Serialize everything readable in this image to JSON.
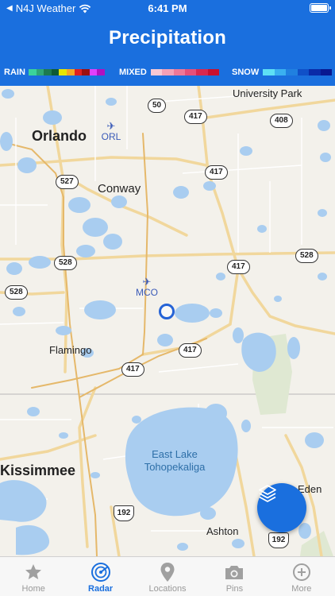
{
  "status_bar": {
    "carrier": "N4J Weather",
    "time": "6:41 PM"
  },
  "header": {
    "title": "Precipitation"
  },
  "legend": {
    "rain_label": "RAIN",
    "mixed_label": "MIXED",
    "snow_label": "SNOW",
    "rain_colors": [
      "#3bd39b",
      "#2fa776",
      "#1d7a4f",
      "#0e5a33",
      "#e6e600",
      "#f5a623",
      "#e02020",
      "#9b1010",
      "#e040fb",
      "#b010c0"
    ],
    "mixed_colors": [
      "#f7c8d4",
      "#f4a0b6",
      "#ee7898",
      "#e5507a",
      "#d8284e",
      "#c8102e"
    ],
    "snow_colors": [
      "#5ee0f5",
      "#3ab0f0",
      "#2080e0",
      "#1050c8",
      "#0a2aa8",
      "#081890"
    ]
  },
  "map": {
    "places": {
      "university_park": "University Park",
      "orlando": "Orlando",
      "conway": "Conway",
      "flamingo": "Flamingo",
      "kissimmee": "Kissimmee",
      "east_lake": "East Lake\nTohopekaliga",
      "eden": "Eden",
      "ashton": "Ashton"
    },
    "airports": {
      "orl": "ORL",
      "mco": "MCO"
    },
    "shields": {
      "r50": "50",
      "r417a": "417",
      "r408": "408",
      "r417b": "417",
      "r527": "527",
      "r528a": "528",
      "r528b": "528",
      "r528c": "528",
      "r417c": "417",
      "r417d": "417",
      "r417e": "417",
      "us192a": "192",
      "us192b": "192"
    }
  },
  "tabs": [
    {
      "label": "Home",
      "icon": "star-icon"
    },
    {
      "label": "Radar",
      "icon": "radar-icon"
    },
    {
      "label": "Locations",
      "icon": "location-pin-icon"
    },
    {
      "label": "Pins",
      "icon": "camera-icon"
    },
    {
      "label": "More",
      "icon": "plus-circle-icon"
    }
  ],
  "accent_color": "#1a6fde"
}
